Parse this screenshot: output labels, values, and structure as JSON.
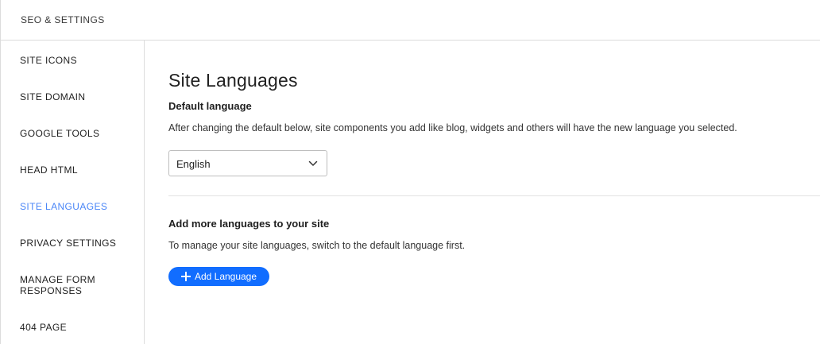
{
  "header": {
    "title": "SEO & SETTINGS"
  },
  "sidebar": {
    "items": [
      {
        "label": "SITE ICONS",
        "active": false
      },
      {
        "label": "SITE DOMAIN",
        "active": false
      },
      {
        "label": "GOOGLE TOOLS",
        "active": false
      },
      {
        "label": "HEAD HTML",
        "active": false
      },
      {
        "label": "SITE LANGUAGES",
        "active": true
      },
      {
        "label": "PRIVACY SETTINGS",
        "active": false
      },
      {
        "label": "MANAGE FORM\nRESPONSES",
        "active": false
      },
      {
        "label": "404 PAGE",
        "active": false
      }
    ]
  },
  "main": {
    "title": "Site Languages",
    "default_language": {
      "heading": "Default language",
      "description": "After changing the default below, site components you add like blog, widgets and others will have the new language you selected.",
      "selected": "English"
    },
    "add_languages": {
      "heading": "Add more languages to your site",
      "description": "To manage your site languages, switch to the default language first.",
      "button_label": "Add Language"
    }
  },
  "colors": {
    "accent": "#116dff",
    "active_nav": "#4a86f7",
    "border": "#dcdcdc"
  },
  "icons": {
    "select_arrow": "chevron-down-icon",
    "add": "plus-icon"
  }
}
